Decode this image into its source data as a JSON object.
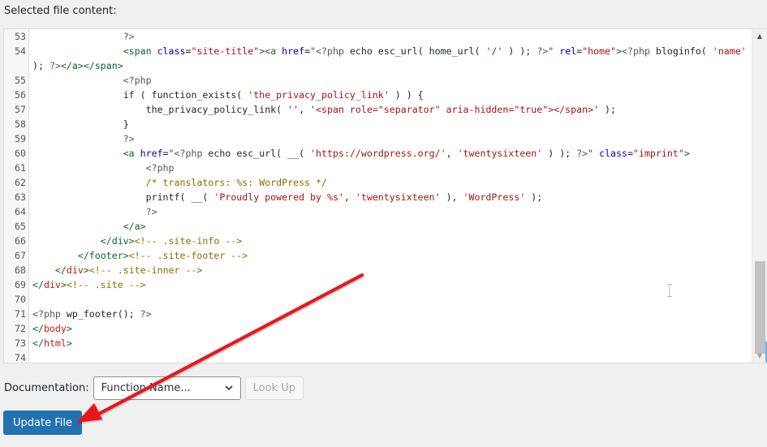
{
  "section_title": "Selected file content:",
  "editor": {
    "lines": [
      {
        "n": "53",
        "tokens": [
          [
            "plain",
            "                "
          ],
          [
            "php",
            "?>"
          ]
        ]
      },
      {
        "n": "54",
        "tokens": [
          [
            "plain",
            "                "
          ],
          [
            "tag",
            "<span "
          ],
          [
            "attr",
            "class"
          ],
          [
            "plain",
            "="
          ],
          [
            "str",
            "\"site-title\""
          ],
          [
            "tag",
            ">"
          ],
          [
            "tag",
            "<a "
          ],
          [
            "attr",
            "href"
          ],
          [
            "plain",
            "="
          ],
          [
            "str",
            "\""
          ],
          [
            "php",
            "<?php "
          ],
          [
            "fn",
            "echo esc_url( home_url( "
          ],
          [
            "str",
            "'/'"
          ],
          [
            "fn",
            " ) ); "
          ],
          [
            "php",
            "?>"
          ],
          [
            "str",
            "\""
          ],
          [
            "plain",
            " "
          ],
          [
            "attr",
            "rel"
          ],
          [
            "plain",
            "="
          ],
          [
            "str",
            "\"home\""
          ],
          [
            "tag",
            ">"
          ],
          [
            "php",
            "<?php "
          ],
          [
            "fn",
            "bloginfo( "
          ],
          [
            "str",
            "'name'"
          ],
          [
            "fn",
            " ); "
          ],
          [
            "php",
            "?>"
          ],
          [
            "tag",
            "</a></span>"
          ]
        ]
      },
      {
        "n": "55",
        "tokens": [
          [
            "plain",
            "                "
          ],
          [
            "php",
            "<?php"
          ]
        ]
      },
      {
        "n": "56",
        "tokens": [
          [
            "plain",
            "                "
          ],
          [
            "kw",
            "if"
          ],
          [
            "fn",
            " ( function_exists( "
          ],
          [
            "str",
            "'the_privacy_policy_link'"
          ],
          [
            "fn",
            " ) ) {"
          ]
        ]
      },
      {
        "n": "57",
        "tokens": [
          [
            "plain",
            "                    "
          ],
          [
            "fn",
            "the_privacy_policy_link( "
          ],
          [
            "str",
            "''"
          ],
          [
            "fn",
            ", "
          ],
          [
            "str",
            "'<span role=\"separator\" aria-hidden=\"true\"></span>'"
          ],
          [
            "fn",
            " );"
          ]
        ]
      },
      {
        "n": "58",
        "tokens": [
          [
            "plain",
            "                "
          ],
          [
            "fn",
            "}"
          ]
        ]
      },
      {
        "n": "59",
        "tokens": [
          [
            "plain",
            "                "
          ],
          [
            "php",
            "?>"
          ]
        ]
      },
      {
        "n": "60",
        "tokens": [
          [
            "plain",
            "                "
          ],
          [
            "tag",
            "<a "
          ],
          [
            "attr",
            "href"
          ],
          [
            "plain",
            "="
          ],
          [
            "str",
            "\""
          ],
          [
            "php",
            "<?php "
          ],
          [
            "fn",
            "echo esc_url( __( "
          ],
          [
            "str",
            "'https://wordpress.org/'"
          ],
          [
            "fn",
            ", "
          ],
          [
            "str",
            "'twentysixteen'"
          ],
          [
            "fn",
            " ) ); "
          ],
          [
            "php",
            "?>"
          ],
          [
            "str",
            "\""
          ],
          [
            "plain",
            " "
          ],
          [
            "attr",
            "class"
          ],
          [
            "plain",
            "="
          ],
          [
            "str",
            "\"imprint\""
          ],
          [
            "tag",
            ">"
          ]
        ]
      },
      {
        "n": "61",
        "tokens": [
          [
            "plain",
            "                    "
          ],
          [
            "php",
            "<?php"
          ]
        ]
      },
      {
        "n": "62",
        "tokens": [
          [
            "plain",
            "                    "
          ],
          [
            "comment",
            "/* translators: %s: WordPress */"
          ]
        ]
      },
      {
        "n": "63",
        "tokens": [
          [
            "plain",
            "                    "
          ],
          [
            "fn",
            "printf( __( "
          ],
          [
            "str",
            "'Proudly powered by %s'"
          ],
          [
            "fn",
            ", "
          ],
          [
            "str",
            "'twentysixteen'"
          ],
          [
            "fn",
            " ), "
          ],
          [
            "str",
            "'WordPress'"
          ],
          [
            "fn",
            " );"
          ]
        ]
      },
      {
        "n": "64",
        "tokens": [
          [
            "plain",
            "                    "
          ],
          [
            "php",
            "?>"
          ]
        ]
      },
      {
        "n": "65",
        "tokens": [
          [
            "plain",
            "                "
          ],
          [
            "tag",
            "</a>"
          ]
        ]
      },
      {
        "n": "66",
        "tokens": [
          [
            "plain",
            "            "
          ],
          [
            "tag",
            "</div>"
          ],
          [
            "comment",
            "<!-- .site-info -->"
          ]
        ]
      },
      {
        "n": "67",
        "tokens": [
          [
            "plain",
            "        "
          ],
          [
            "tag",
            "</footer>"
          ],
          [
            "comment",
            "<!-- .site-footer -->"
          ]
        ]
      },
      {
        "n": "68",
        "tokens": [
          [
            "plain",
            "    "
          ],
          [
            "tag",
            "</"
          ],
          [
            "tagred",
            "div"
          ],
          [
            "tag",
            ">"
          ],
          [
            "comment",
            "<!-- .site-inner -->"
          ]
        ]
      },
      {
        "n": "69",
        "tokens": [
          [
            "tag",
            "</"
          ],
          [
            "tagred",
            "div"
          ],
          [
            "tag",
            ">"
          ],
          [
            "comment",
            "<!-- .site -->"
          ]
        ]
      },
      {
        "n": "70",
        "tokens": []
      },
      {
        "n": "71",
        "tokens": [
          [
            "php",
            "<?php "
          ],
          [
            "fn",
            "wp_footer(); "
          ],
          [
            "php",
            "?>"
          ]
        ]
      },
      {
        "n": "72",
        "tokens": [
          [
            "tag",
            "</"
          ],
          [
            "tagred",
            "body"
          ],
          [
            "tag",
            ">"
          ]
        ]
      },
      {
        "n": "73",
        "tokens": [
          [
            "tag",
            "</"
          ],
          [
            "tagred",
            "html"
          ],
          [
            "tag",
            ">"
          ]
        ]
      },
      {
        "n": "74",
        "tokens": []
      }
    ]
  },
  "documentation": {
    "label": "Documentation:",
    "select_value": "Function Name...",
    "lookup_label": "Look Up"
  },
  "update_button": "Update File",
  "colors": {
    "primary_button": "#2271b1",
    "annotation_arrow": "#e8141b"
  }
}
